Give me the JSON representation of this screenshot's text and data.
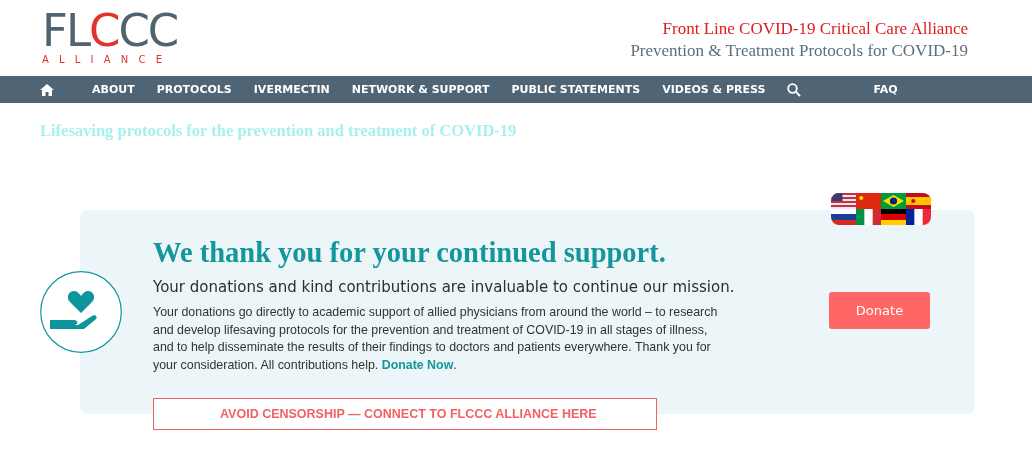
{
  "logo": {
    "wordmark_start": "FL",
    "wordmark_accent": "C",
    "wordmark_end": "CC",
    "subtitle": "ALLIANCE"
  },
  "header": {
    "title": "Front Line COVID-19 Critical Care Alliance",
    "subtitle": "Prevention & Treatment Protocols for COVID-19"
  },
  "nav": {
    "items": [
      {
        "kind": "home"
      },
      {
        "kind": "link",
        "label": "ABOUT"
      },
      {
        "kind": "link",
        "label": "PROTOCOLS"
      },
      {
        "kind": "link",
        "label": "IVERMECTIN"
      },
      {
        "kind": "link",
        "label": "NETWORK & SUPPORT"
      },
      {
        "kind": "link",
        "label": "PUBLIC STATEMENTS"
      },
      {
        "kind": "link",
        "label": "VIDEOS & PRESS"
      },
      {
        "kind": "search"
      },
      {
        "kind": "link",
        "label": "FAQ"
      }
    ]
  },
  "tagline": "Lifesaving protocols for the prevention and treatment of COVID-19",
  "languages": [
    {
      "kind": "us"
    },
    {
      "kind": "cn"
    },
    {
      "kind": "br"
    },
    {
      "kind": "es"
    },
    {
      "kind": "ru"
    },
    {
      "kind": "it"
    },
    {
      "kind": "de"
    },
    {
      "kind": "fr"
    }
  ],
  "donation": {
    "title": "We thank you for your continued support.",
    "subtitle": "Your donations and kind contributions are invaluable to continue our mission.",
    "body": "Your donations go directly to academic support of allied physicians from around the world – to research and develop lifesaving protocols for the prevention and treatment of COVID-19 in all stages of illness, and to help disseminate the results of their findings to doctors and patients everywhere. Thank you for your consideration. All contributions help.",
    "link": "Donate Now",
    "after_link": ".",
    "button": "Donate",
    "banner": "AVOID CENSORSHIP — CONNECT TO FLCCC ALLIANCE HERE"
  }
}
